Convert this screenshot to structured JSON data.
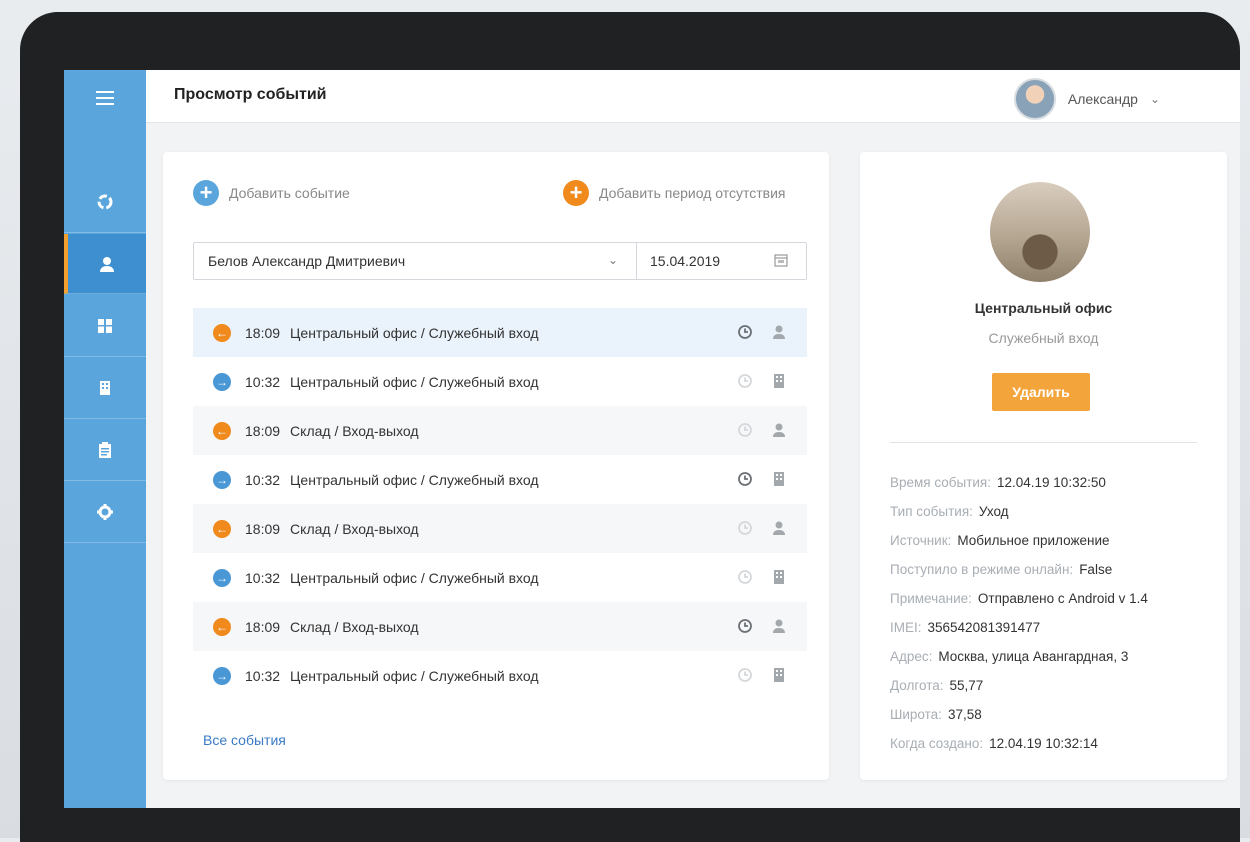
{
  "header": {
    "title": "Просмотр событий",
    "user_name": "Александр"
  },
  "sidebar": {
    "items": [
      {
        "icon": "refresh-icon",
        "active": false
      },
      {
        "icon": "user-icon",
        "active": true
      },
      {
        "icon": "grid-icon",
        "active": false
      },
      {
        "icon": "building-icon",
        "active": false
      },
      {
        "icon": "clipboard-icon",
        "active": false
      },
      {
        "icon": "gear-icon",
        "active": false
      }
    ]
  },
  "actions": {
    "add_event": "Добавить событие",
    "add_absence": "Добавить период отсутствия"
  },
  "filter": {
    "employee": "Белов Александр Дмитриевич",
    "date": "15.04.2019"
  },
  "events": [
    {
      "dir": "out",
      "time": "18:09",
      "place": "Центральный офис / Служебный вход",
      "clock": "dark",
      "src": "user"
    },
    {
      "dir": "in",
      "time": "10:32",
      "place": "Центральный офис / Служебный вход",
      "clock": "light",
      "src": "building"
    },
    {
      "dir": "out",
      "time": "18:09",
      "place": "Склад / Вход-выход",
      "clock": "light",
      "src": "user"
    },
    {
      "dir": "in",
      "time": "10:32",
      "place": "Центральный офис / Служебный вход",
      "clock": "dark",
      "src": "building"
    },
    {
      "dir": "out",
      "time": "18:09",
      "place": "Склад / Вход-выход",
      "clock": "light",
      "src": "user"
    },
    {
      "dir": "in",
      "time": "10:32",
      "place": "Центральный офис / Служебный вход",
      "clock": "light",
      "src": "building"
    },
    {
      "dir": "out",
      "time": "18:09",
      "place": "Склад / Вход-выход",
      "clock": "dark",
      "src": "user"
    },
    {
      "dir": "in",
      "time": "10:32",
      "place": "Центральный офис / Служебный вход",
      "clock": "light",
      "src": "building"
    }
  ],
  "all_events_link": "Все события",
  "detail": {
    "place_title": "Центральный офис",
    "place_sub": "Служебный вход",
    "delete_label": "Удалить",
    "rows": [
      {
        "k": "Время события:",
        "v": "12.04.19 10:32:50"
      },
      {
        "k": "Тип события:",
        "v": "Уход"
      },
      {
        "k": "Источник:",
        "v": "Мобильное приложение"
      },
      {
        "k": "Поступило в режиме онлайн:",
        "v": "False"
      },
      {
        "k": "Примечание:",
        "v": "Отправлено с Android  v 1.4"
      },
      {
        "k": "IMEI:",
        "v": "356542081391477"
      },
      {
        "k": "Адрес:",
        "v": "Москва, улица Авангардная, 3"
      },
      {
        "k": "Долгота:",
        "v": "55,77"
      },
      {
        "k": "Широта:",
        "v": "37,58"
      },
      {
        "k": "Когда создано:",
        "v": "12.04.19 10:32:14"
      }
    ]
  },
  "colors": {
    "sidebar": "#5aa5dc",
    "accent_orange": "#f08a1c",
    "accent_blue": "#4a97d6",
    "delete_button": "#f3a43a"
  }
}
